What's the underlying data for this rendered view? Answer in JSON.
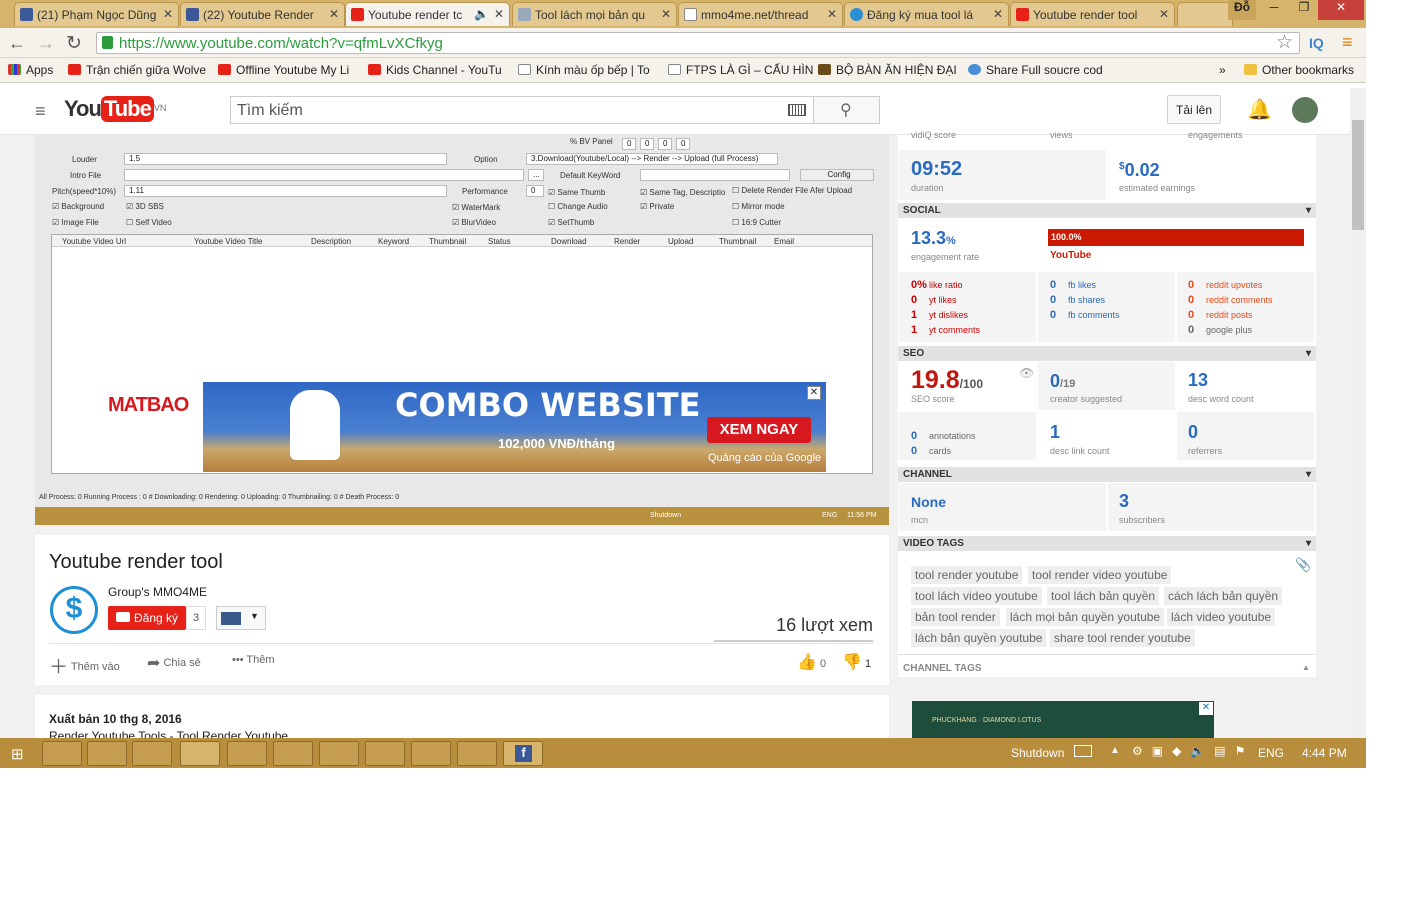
{
  "tabs": [
    {
      "label": "(21) Phạm Ngọc Dũng",
      "icon": "facebook-icon"
    },
    {
      "label": "(22) Youtube Render",
      "icon": "facebook-icon"
    },
    {
      "label": "Youtube render tc",
      "icon": "youtube-icon"
    },
    {
      "label": "Tool lách mọi bản qu",
      "icon": "loading-icon"
    },
    {
      "label": "mmo4me.net/thread",
      "icon": "page-icon"
    },
    {
      "label": "Đăng ký mua tool lá",
      "icon": "dollar-icon"
    },
    {
      "label": "Youtube render tool",
      "icon": "youtube-icon"
    }
  ],
  "window": {
    "user": "Đỗ",
    "minimize": "─",
    "maximize": "❐",
    "close": "✕"
  },
  "url": "https://www.youtube.com/watch?v=qfmLvXCfkyg",
  "bookmarks": [
    "Apps",
    "Trận chiến giữa Wolve",
    "Offline Youtube My Li",
    "Kids Channel - YouTu",
    "Kính màu ốp bếp | To",
    "FTPS LÀ GÌ – CẤU HÌN",
    "BỘ BÀN ĂN HIỆN ĐẠI",
    "Share Full soucre cod",
    "»",
    "Other bookmarks"
  ],
  "yt": {
    "logo_you": "You",
    "logo_tube": "Tube",
    "region": "VN",
    "search_placeholder": "Tìm kiếm",
    "upload": "Tải lên"
  },
  "app": {
    "bv_panel": "% BV Panel",
    "bv_vals": [
      "0",
      "0",
      "0",
      "0"
    ],
    "loudder": "Louder",
    "loudder_val": "1.5",
    "option": "Option",
    "option_val": "3.Download(Youtube/Local) --> Render --> Upload (full Process)",
    "intro": "Intro File",
    "dots": "...",
    "default_kw": "Default KeyWord",
    "config": "Config",
    "pitch": "Pitch(speed*10%)",
    "pitch_val": "1.11",
    "performance": "Performance",
    "perf_val": "0",
    "checks": [
      "Background",
      "3D SBS",
      "WaterMark",
      "Change Audio",
      "Private",
      "Mirror mode",
      "Image File",
      "Self Video",
      "BlurVideo",
      "SetThumb",
      "16:9 Cutter",
      "Same Thumb",
      "Same Tag, Descriptio",
      "Delete Render File Afer Upload"
    ],
    "cols": [
      "Youtube Video Url",
      "Youtube Video Title",
      "Description",
      "Keyword",
      "Thumbnail",
      "Status",
      "Download",
      "Render",
      "Upload",
      "Thumbnail",
      "Email"
    ],
    "status": "All Process: 0 Running Process : 0 # Downloading: 0 Rendering: 0 Uploading: 0 Thumbnailing: 0 # Death Process: 0",
    "shutdown": "Shutdown",
    "lang": "ENG",
    "time": "11:56 PM"
  },
  "ad": {
    "brand": "MATBAO",
    "headline": "COMBO WEBSITE",
    "price": "102,000 VNĐ/tháng",
    "cta": "XEM NGAY",
    "by": "Quảng cáo của Google"
  },
  "video": {
    "title": "Youtube render tool",
    "channel": "Group's MMO4ME",
    "subscribe": "Đăng ký",
    "sub_count": "3",
    "views": "16 lượt xem",
    "add": "Thêm vào",
    "share": "Chia sẻ",
    "more": "Thêm",
    "likes": "0",
    "dislikes": "1",
    "published": "Xuất bản 10 thg 8, 2016",
    "desc_line": "Render Youtube Tools - Tool Render Youtube"
  },
  "vidiq": {
    "top": [
      "vidiQ score",
      "views",
      "engagements"
    ],
    "duration": "09:52",
    "duration_label": "duration",
    "earn_cur": "$",
    "earn": "0.02",
    "earn_label": "estimated earnings",
    "social": "SOCIAL",
    "eng_rate": "13.3",
    "eng_pct": "%",
    "eng_label": "engagement rate",
    "yt_pct": "100.0%",
    "yt_label": "YouTube",
    "col1": [
      {
        "v": "0%",
        "l": "like ratio"
      },
      {
        "v": "0",
        "l": "yt likes"
      },
      {
        "v": "1",
        "l": "yt dislikes"
      },
      {
        "v": "1",
        "l": "yt comments"
      }
    ],
    "col2": [
      {
        "v": "0",
        "l": "fb likes"
      },
      {
        "v": "0",
        "l": "fb shares"
      },
      {
        "v": "0",
        "l": "fb comments"
      }
    ],
    "col3": [
      {
        "v": "0",
        "l": "reddit upvotes"
      },
      {
        "v": "0",
        "l": "reddit comments"
      },
      {
        "v": "0",
        "l": "reddit posts"
      },
      {
        "v": "0",
        "l": "google plus"
      }
    ],
    "seo": "SEO",
    "seo_score": "19.8",
    "seo_max": "/100",
    "seo_label": "SEO score",
    "creator": "0",
    "creator_max": "/19",
    "creator_label": "creator suggested",
    "desc_words": "13",
    "desc_words_label": "desc word count",
    "annotations": "0",
    "annotations_label": "annotations",
    "cards": "0",
    "cards_label": "cards",
    "links": "1",
    "links_label": "desc link count",
    "referrers": "0",
    "referrers_label": "referrers",
    "channel": "CHANNEL",
    "mcn": "None",
    "mcn_label": "mcn",
    "subs": "3",
    "subs_label": "subscribers",
    "tags_hdr": "VIDEO TAGS",
    "tags": [
      "tool render youtube",
      "tool render video youtube",
      "tool lách video youtube",
      "tool lách bản quyền",
      "cách lách bản quyền",
      "bản tool render",
      "lách mọi bản quyền youtube",
      "lách video youtube",
      "lách bản quyền youtube",
      "share tool render youtube"
    ],
    "ch_tags": "CHANNEL TAGS",
    "side_ad": "PHUCKHANG · DIAMOND LOTUS"
  },
  "taskbar": {
    "shutdown": "Shutdown",
    "lang": "ENG",
    "time": "4:44 PM"
  }
}
